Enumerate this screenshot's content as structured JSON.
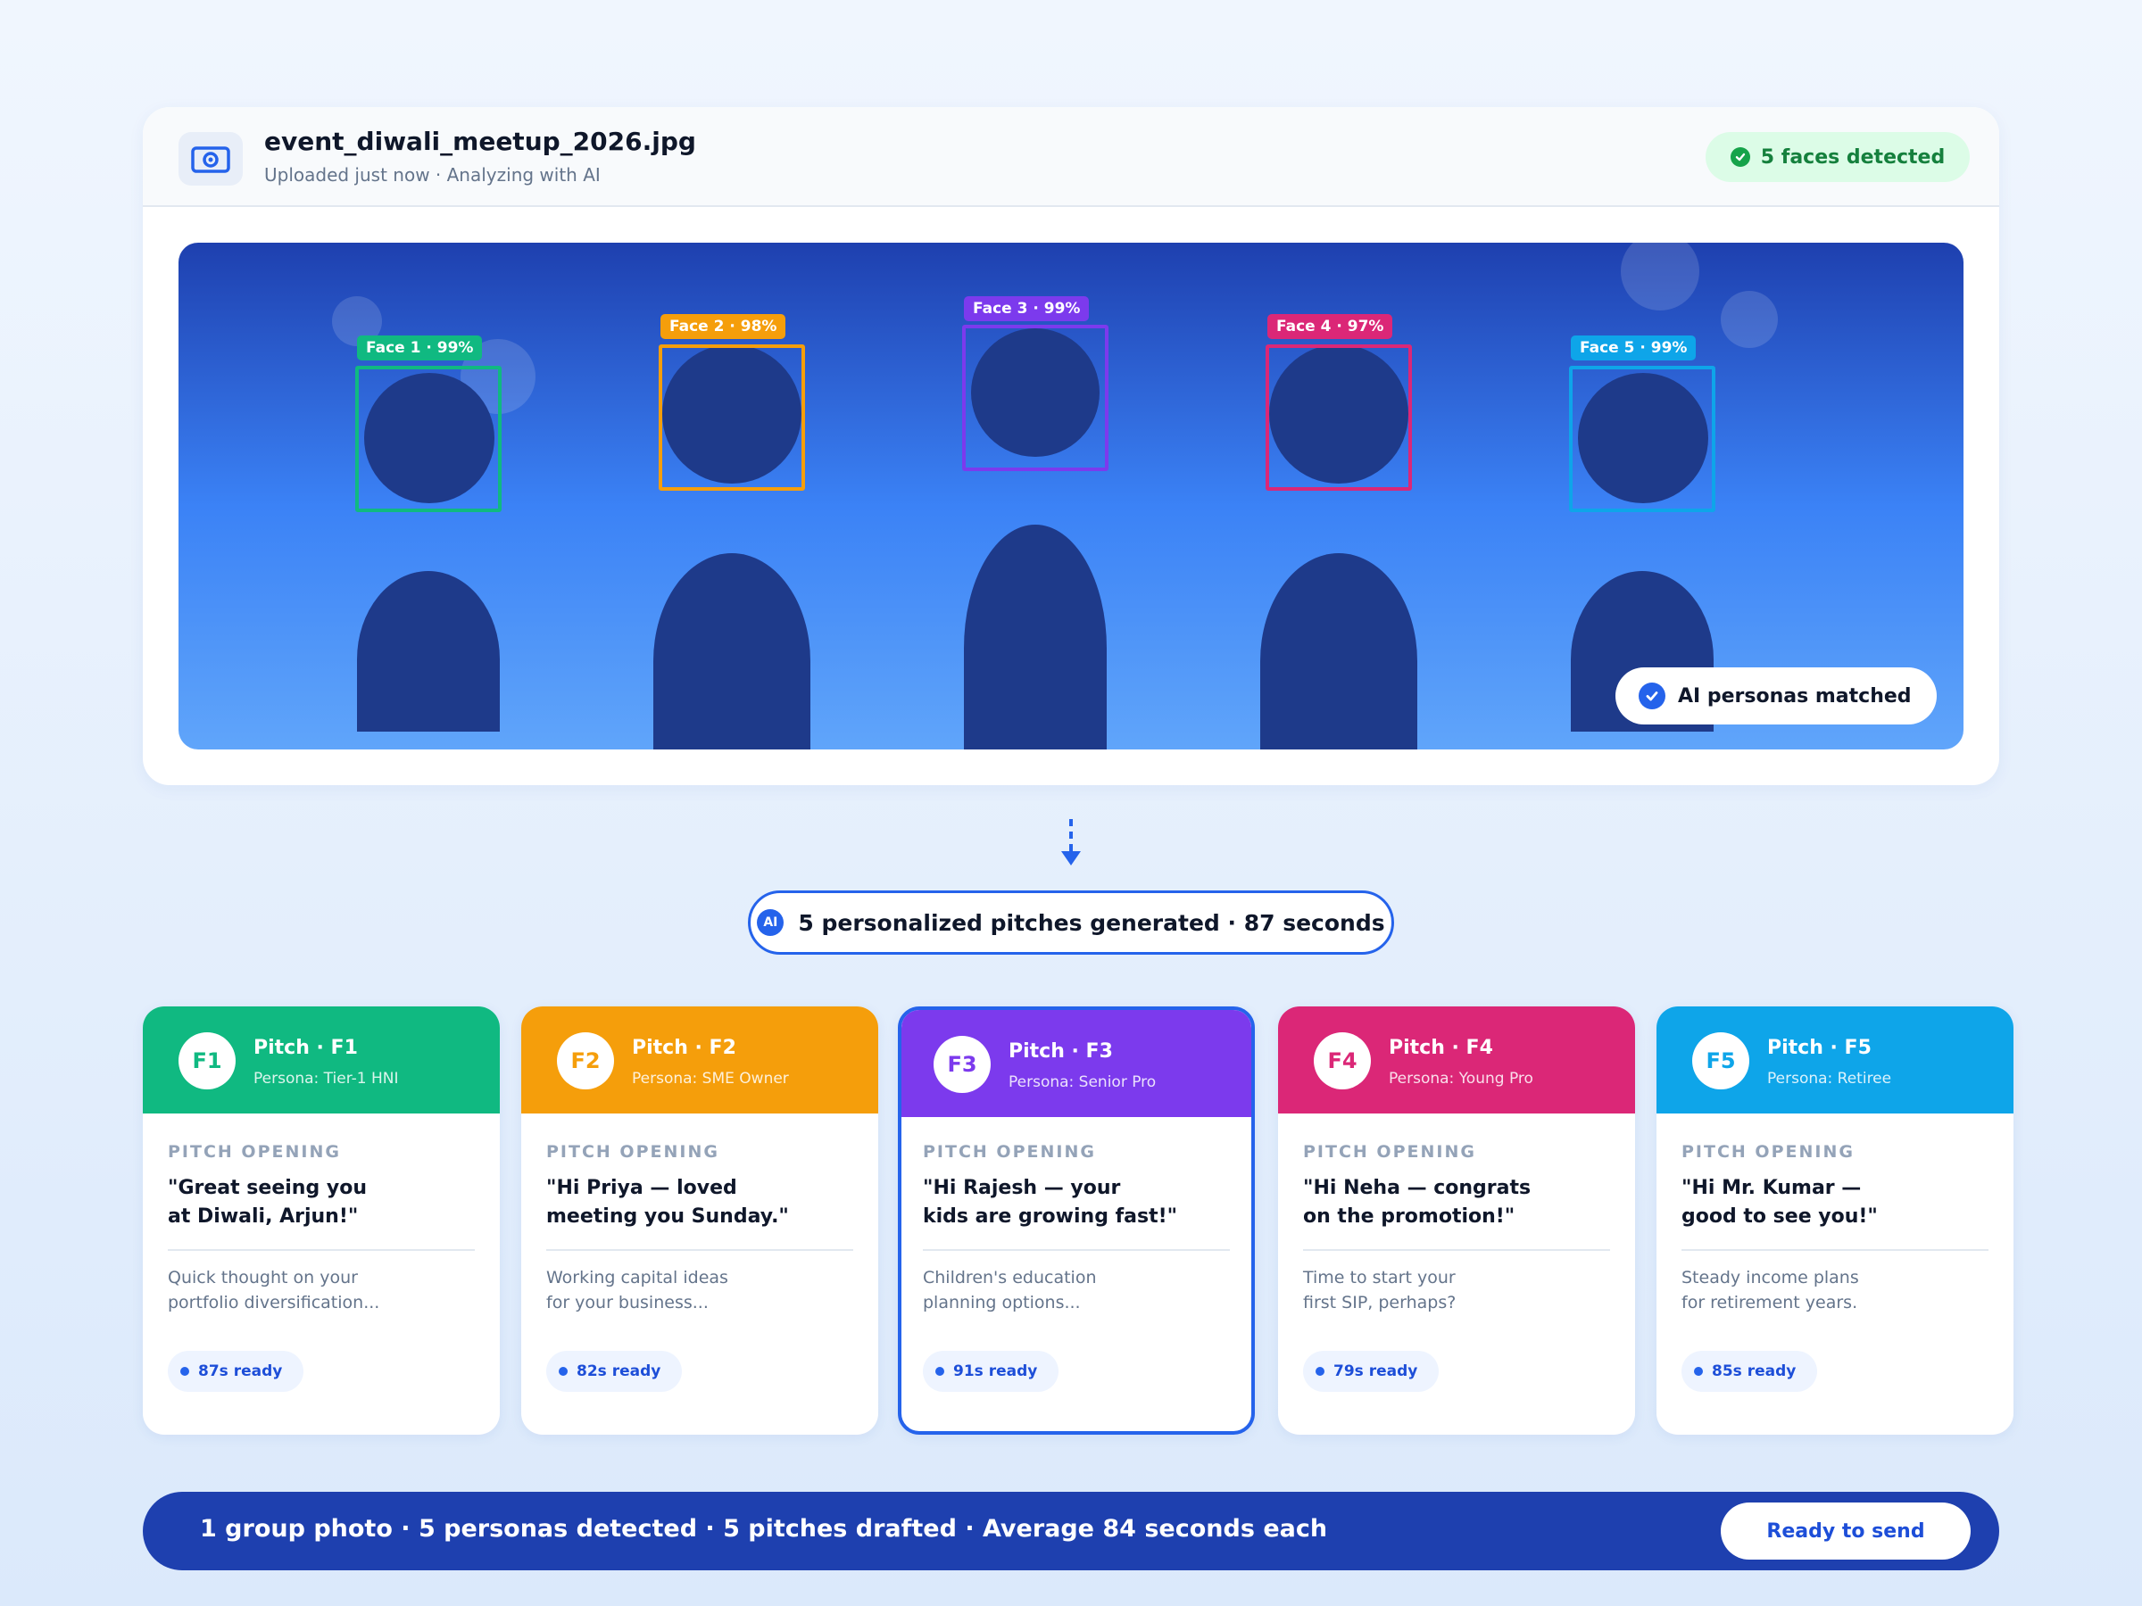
{
  "upload": {
    "file_name": "event_diwali_meetup_2026.jpg",
    "subtitle": "Uploaded just now · Analyzing with AI",
    "faces_badge": "5 faces detected",
    "matched_badge": "AI personas matched",
    "file_icon": "camera-icon"
  },
  "faces": [
    {
      "label": "Face 1 · 99%",
      "color": "#10b981"
    },
    {
      "label": "Face 2 · 98%",
      "color": "#f59e0b"
    },
    {
      "label": "Face 3 · 99%",
      "color": "#7c3aed"
    },
    {
      "label": "Face 4 · 97%",
      "color": "#db2777"
    },
    {
      "label": "Face 5 · 99%",
      "color": "#0ea5e9"
    }
  ],
  "generation": {
    "ai_label": "AI",
    "text": "5 personalized pitches generated · 87 seconds"
  },
  "pitches": [
    {
      "avatar": "F1",
      "title": "Pitch · F1",
      "persona": "Persona: Tier-1 HNI",
      "section_label": "PITCH OPENING",
      "quote": "\"Great seeing you\nat Diwali, Arjun!\"",
      "snippet": "Quick thought on your\nportfolio diversification...",
      "ready": "87s ready",
      "color": "#10b981",
      "highlighted": false
    },
    {
      "avatar": "F2",
      "title": "Pitch · F2",
      "persona": "Persona: SME Owner",
      "section_label": "PITCH OPENING",
      "quote": "\"Hi Priya — loved\nmeeting you Sunday.\"",
      "snippet": "Working capital ideas\nfor your business...",
      "ready": "82s ready",
      "color": "#f59e0b",
      "highlighted": false
    },
    {
      "avatar": "F3",
      "title": "Pitch · F3",
      "persona": "Persona: Senior Pro",
      "section_label": "PITCH OPENING",
      "quote": "\"Hi Rajesh — your\nkids are growing fast!\"",
      "snippet": "Children's education\nplanning options...",
      "ready": "91s ready",
      "color": "#7c3aed",
      "highlighted": true
    },
    {
      "avatar": "F4",
      "title": "Pitch · F4",
      "persona": "Persona: Young Pro",
      "section_label": "PITCH OPENING",
      "quote": "\"Hi Neha — congrats\non the promotion!\"",
      "snippet": "Time to start your\nfirst SIP, perhaps?",
      "ready": "79s ready",
      "color": "#db2777",
      "highlighted": false
    },
    {
      "avatar": "F5",
      "title": "Pitch · F5",
      "persona": "Persona: Retiree",
      "section_label": "PITCH OPENING",
      "quote": "\"Hi Mr. Kumar —\ngood to see you!\"",
      "snippet": "Steady income plans\nfor retirement years.",
      "ready": "85s ready",
      "color": "#0ea5e9",
      "highlighted": false
    }
  ],
  "footer": {
    "summary": "1 group photo · 5 personas detected · 5 pitches drafted · Average 84 seconds each",
    "send_label": "Ready to send"
  }
}
